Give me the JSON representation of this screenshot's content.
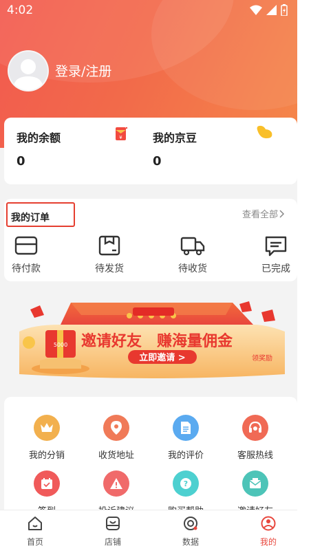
{
  "status": {
    "time": "4:02"
  },
  "user": {
    "login_label": "登录/注册"
  },
  "wallet": {
    "balance_label": "我的余额",
    "balance_value": "0",
    "beans_label": "我的京豆",
    "beans_value": "0"
  },
  "orders": {
    "title": "我的订单",
    "view_all": "查看全部",
    "items": [
      {
        "label": "待付款",
        "icon": "wallet-icon"
      },
      {
        "label": "待发货",
        "icon": "box-icon"
      },
      {
        "label": "待收货",
        "icon": "truck-icon"
      },
      {
        "label": "已完成",
        "icon": "message-check-icon"
      }
    ]
  },
  "banner": {
    "title_left": "邀请好友",
    "title_right": "赚海量佣金",
    "cta": "立即邀请 >",
    "tag": "领奖励",
    "badge": "5000"
  },
  "services": [
    {
      "label": "我的分销",
      "icon": "crown-icon",
      "color": "#f2b04e"
    },
    {
      "label": "收货地址",
      "icon": "location-pin-icon",
      "color": "#f07a58"
    },
    {
      "label": "我的评价",
      "icon": "document-icon",
      "color": "#5aaaf0"
    },
    {
      "label": "客服热线",
      "icon": "headset-icon",
      "color": "#f06a55"
    },
    {
      "label": "签到",
      "icon": "calendar-check-icon",
      "color": "#f05a5a"
    },
    {
      "label": "投诉建议",
      "icon": "warning-icon",
      "color": "#f06a6a"
    },
    {
      "label": "购买帮助",
      "icon": "question-icon",
      "color": "#4dd0d0"
    },
    {
      "label": "邀请好友",
      "icon": "envelope-icon",
      "color": "#4dc4b8"
    }
  ],
  "tabbar": [
    {
      "label": "首页",
      "icon": "home-icon"
    },
    {
      "label": "店铺",
      "icon": "shop-icon"
    },
    {
      "label": "数据",
      "icon": "data-icon"
    },
    {
      "label": "我的",
      "icon": "profile-icon"
    }
  ],
  "colors": {
    "accent": "#e8473d",
    "header_start": "#f25a4f",
    "header_end": "#f5874a"
  }
}
